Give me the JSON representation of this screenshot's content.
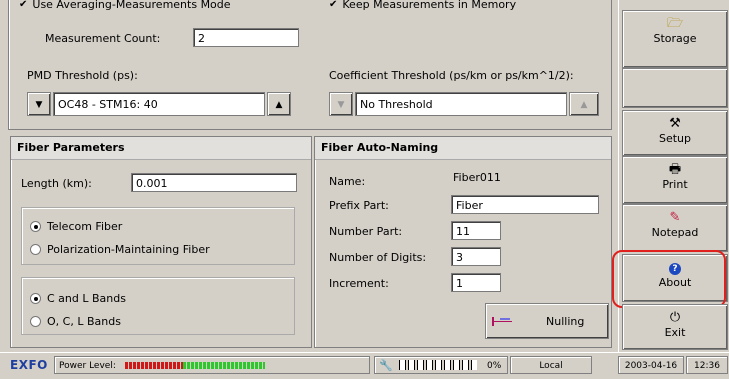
{
  "top": {
    "averaging_label": "Use Averaging-Measurements Mode",
    "keep_label": "Keep Measurements in Memory",
    "count_label": "Measurement Count:",
    "count_value": "2",
    "pmd_label": "PMD Threshold (ps):",
    "pmd_value": "OC48 - STM16: 40",
    "coef_label": "Coefficient Threshold (ps/km or ps/km^1/2):",
    "coef_value": "No Threshold"
  },
  "fiber_params": {
    "title": "Fiber Parameters",
    "length_label": "Length (km):",
    "length_value": "0.001",
    "fiber_types": [
      {
        "label": "Telecom Fiber",
        "selected": true
      },
      {
        "label": "Polarization-Maintaining Fiber",
        "selected": false
      }
    ],
    "bands": [
      {
        "label": "C and L Bands",
        "selected": true
      },
      {
        "label": "O, C, L Bands",
        "selected": false
      }
    ]
  },
  "auto_naming": {
    "title": "Fiber Auto-Naming",
    "name_label": "Name:",
    "name_value": "Fiber011",
    "prefix_label": "Prefix Part:",
    "prefix_value": "Fiber",
    "number_label": "Number Part:",
    "number_value": "11",
    "digits_label": "Number of Digits:",
    "digits_value": "3",
    "increment_label": "Increment:",
    "increment_value": "1",
    "nulling_label": "Nulling"
  },
  "sidebar": {
    "storage": "Storage",
    "setup": "Setup",
    "print": "Print",
    "notepad": "Notepad",
    "about": "About",
    "exit": "Exit"
  },
  "status": {
    "brand": "EXFO",
    "power_label": "Power Level:",
    "progress": "0%",
    "progress_fraction": 0.0,
    "mode": "Local",
    "date": "2003-04-16",
    "time": "12:36"
  },
  "colors": {
    "highlight": "#e0201c",
    "brand": "#1f3fa0",
    "power_red": "#d01818",
    "power_green": "#2ec82e"
  }
}
